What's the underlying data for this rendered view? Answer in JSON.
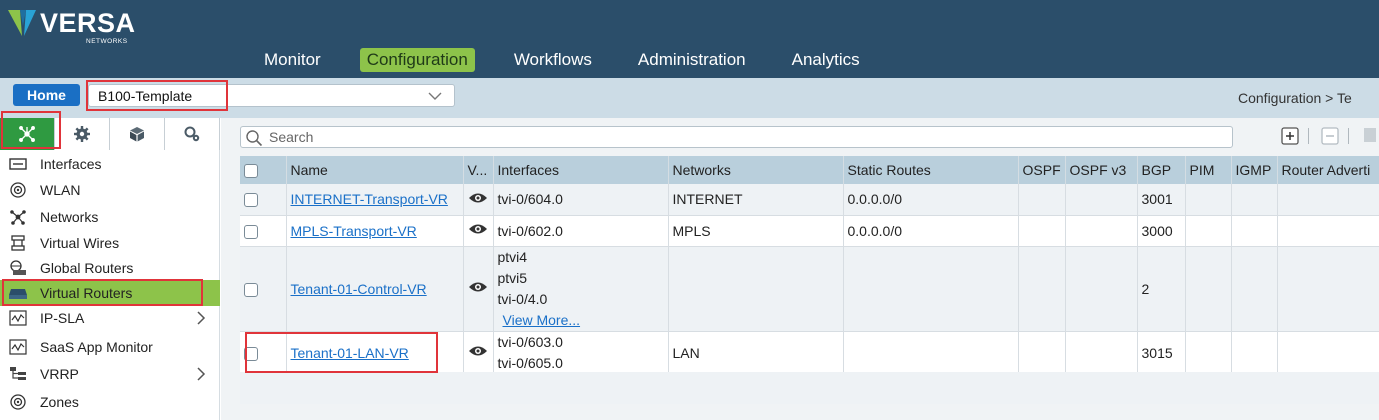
{
  "brand": {
    "name": "VERSA",
    "sub": "NETWORKS",
    "accent": "#8dc34a",
    "header_bg": "#2b4e6a"
  },
  "nav": [
    {
      "label": "Monitor",
      "active": false
    },
    {
      "label": "Configuration",
      "active": true
    },
    {
      "label": "Workflows",
      "active": false
    },
    {
      "label": "Administration",
      "active": false
    },
    {
      "label": "Analytics",
      "active": false
    }
  ],
  "home_label": "Home",
  "template": {
    "value": "B100-Template"
  },
  "breadcrumb": "Configuration  >  Te",
  "sidebar_tabs": [
    {
      "icon": "network-nodes-icon",
      "active": true
    },
    {
      "icon": "gear-icon",
      "active": false
    },
    {
      "icon": "cube-icon",
      "active": false
    },
    {
      "icon": "settings-services-icon",
      "active": false
    }
  ],
  "sidebar": {
    "items": [
      {
        "label": "Interfaces",
        "icon": "interface-icon"
      },
      {
        "label": "WLAN",
        "icon": "wifi-icon"
      },
      {
        "label": "Networks",
        "icon": "networks-icon"
      },
      {
        "label": "Virtual Wires",
        "icon": "virtual-wires-icon"
      },
      {
        "label": "Global Routers",
        "icon": "global-router-icon"
      },
      {
        "label": "Virtual Routers",
        "icon": "virtual-router-icon",
        "active": true
      },
      {
        "label": "IP-SLA",
        "icon": "ip-sla-icon",
        "expandable": true
      },
      {
        "label": "SaaS App Monitor",
        "icon": "saas-monitor-icon"
      },
      {
        "label": "VRRP",
        "icon": "vrrp-icon",
        "expandable": true
      },
      {
        "label": "Zones",
        "icon": "zones-icon"
      }
    ]
  },
  "search": {
    "placeholder": "Search"
  },
  "table": {
    "columns": [
      "Name",
      "V...",
      "Interfaces",
      "Networks",
      "Static Routes",
      "OSPF",
      "OSPF v3",
      "BGP",
      "PIM",
      "IGMP",
      "Router Adverti"
    ],
    "rows": [
      {
        "name": "INTERNET-Transport-VR",
        "interfaces": [
          "tvi-0/604.0"
        ],
        "networks": "INTERNET",
        "static_routes": "0.0.0.0/0",
        "ospf": "",
        "ospfv3": "",
        "bgp": "3001",
        "pim": "",
        "igmp": "",
        "ra": ""
      },
      {
        "name": "MPLS-Transport-VR",
        "interfaces": [
          "tvi-0/602.0"
        ],
        "networks": "MPLS",
        "static_routes": "0.0.0.0/0",
        "ospf": "",
        "ospfv3": "",
        "bgp": "3000",
        "pim": "",
        "igmp": "",
        "ra": ""
      },
      {
        "name": "Tenant-01-Control-VR",
        "interfaces": [
          "ptvi4",
          "ptvi5",
          "tvi-0/4.0"
        ],
        "view_more": "View More...",
        "networks": "",
        "static_routes": "",
        "ospf": "",
        "ospfv3": "",
        "bgp": "2",
        "pim": "",
        "igmp": "",
        "ra": ""
      },
      {
        "name": "Tenant-01-LAN-VR",
        "interfaces": [
          "tvi-0/603.0",
          "tvi-0/605.0"
        ],
        "networks": "LAN",
        "static_routes": "",
        "ospf": "",
        "ospfv3": "",
        "bgp": "3015",
        "pim": "",
        "igmp": "",
        "ra": ""
      }
    ]
  }
}
